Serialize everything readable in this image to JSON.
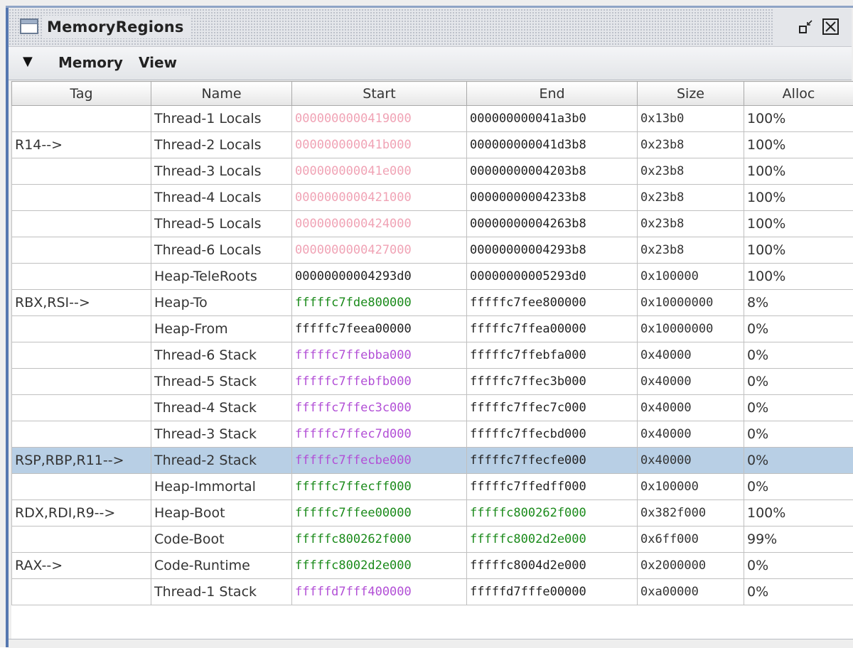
{
  "window": {
    "title": "MemoryRegions",
    "icons": {
      "window": "window-icon",
      "restore": "restore-icon",
      "close": "close-icon"
    }
  },
  "menubar": {
    "dropdown_icon": "▼",
    "items": [
      "Memory",
      "View"
    ]
  },
  "table": {
    "columns": [
      "Tag",
      "Name",
      "Start",
      "End",
      "Size",
      "Alloc"
    ],
    "selected_row_index": 13,
    "colors": {
      "pink": "#f0a3b5",
      "green": "#1a8a1a",
      "purple": "#b24fd6",
      "black": "#222222",
      "selected_bg": "#b8cfe5"
    },
    "rows": [
      {
        "tag": "",
        "name": "Thread-1 Locals",
        "start": "0000000000419000",
        "start_color": "pink",
        "end": "000000000041a3b0",
        "end_color": "black",
        "size": "0x13b0",
        "alloc": "100%"
      },
      {
        "tag": "R14-->",
        "name": "Thread-2 Locals",
        "start": "000000000041b000",
        "start_color": "pink",
        "end": "000000000041d3b8",
        "end_color": "black",
        "size": "0x23b8",
        "alloc": "100%"
      },
      {
        "tag": "",
        "name": "Thread-3 Locals",
        "start": "000000000041e000",
        "start_color": "pink",
        "end": "00000000004203b8",
        "end_color": "black",
        "size": "0x23b8",
        "alloc": "100%"
      },
      {
        "tag": "",
        "name": "Thread-4 Locals",
        "start": "0000000000421000",
        "start_color": "pink",
        "end": "00000000004233b8",
        "end_color": "black",
        "size": "0x23b8",
        "alloc": "100%"
      },
      {
        "tag": "",
        "name": "Thread-5 Locals",
        "start": "0000000000424000",
        "start_color": "pink",
        "end": "00000000004263b8",
        "end_color": "black",
        "size": "0x23b8",
        "alloc": "100%"
      },
      {
        "tag": "",
        "name": "Thread-6 Locals",
        "start": "0000000000427000",
        "start_color": "pink",
        "end": "00000000004293b8",
        "end_color": "black",
        "size": "0x23b8",
        "alloc": "100%"
      },
      {
        "tag": "",
        "name": "Heap-TeleRoots",
        "start": "00000000004293d0",
        "start_color": "black",
        "end": "00000000005293d0",
        "end_color": "black",
        "size": "0x100000",
        "alloc": "100%"
      },
      {
        "tag": "RBX,RSI-->",
        "name": "Heap-To",
        "start": "fffffc7fde800000",
        "start_color": "green",
        "end": "fffffc7fee800000",
        "end_color": "black",
        "size": "0x10000000",
        "alloc": "8%"
      },
      {
        "tag": "",
        "name": "Heap-From",
        "start": "fffffc7feea00000",
        "start_color": "black",
        "end": "fffffc7ffea00000",
        "end_color": "black",
        "size": "0x10000000",
        "alloc": "0%"
      },
      {
        "tag": "",
        "name": "Thread-6 Stack",
        "start": "fffffc7ffebba000",
        "start_color": "purple",
        "end": "fffffc7ffebfa000",
        "end_color": "black",
        "size": "0x40000",
        "alloc": "0%"
      },
      {
        "tag": "",
        "name": "Thread-5 Stack",
        "start": "fffffc7ffebfb000",
        "start_color": "purple",
        "end": "fffffc7ffec3b000",
        "end_color": "black",
        "size": "0x40000",
        "alloc": "0%"
      },
      {
        "tag": "",
        "name": "Thread-4 Stack",
        "start": "fffffc7ffec3c000",
        "start_color": "purple",
        "end": "fffffc7ffec7c000",
        "end_color": "black",
        "size": "0x40000",
        "alloc": "0%"
      },
      {
        "tag": "",
        "name": "Thread-3 Stack",
        "start": "fffffc7ffec7d000",
        "start_color": "purple",
        "end": "fffffc7ffecbd000",
        "end_color": "black",
        "size": "0x40000",
        "alloc": "0%"
      },
      {
        "tag": "RSP,RBP,R11-->",
        "name": "Thread-2 Stack",
        "start": "fffffc7ffecbe000",
        "start_color": "purple",
        "end": "fffffc7ffecfe000",
        "end_color": "black",
        "size": "0x40000",
        "alloc": "0%"
      },
      {
        "tag": "",
        "name": "Heap-Immortal",
        "start": "fffffc7ffecff000",
        "start_color": "green",
        "end": "fffffc7ffedff000",
        "end_color": "black",
        "size": "0x100000",
        "alloc": "0%"
      },
      {
        "tag": "RDX,RDI,R9-->",
        "name": "Heap-Boot",
        "start": "fffffc7ffee00000",
        "start_color": "green",
        "end": "fffffc800262f000",
        "end_color": "green",
        "size": "0x382f000",
        "alloc": "100%"
      },
      {
        "tag": "",
        "name": "Code-Boot",
        "start": "fffffc800262f000",
        "start_color": "green",
        "end": "fffffc8002d2e000",
        "end_color": "green",
        "size": "0x6ff000",
        "alloc": "99%"
      },
      {
        "tag": "RAX-->",
        "name": "Code-Runtime",
        "start": "fffffc8002d2e000",
        "start_color": "green",
        "end": "fffffc8004d2e000",
        "end_color": "black",
        "size": "0x2000000",
        "alloc": "0%"
      },
      {
        "tag": "",
        "name": "Thread-1 Stack",
        "start": "fffffd7fff400000",
        "start_color": "purple",
        "end": "fffffd7fffe00000",
        "end_color": "black",
        "size": "0xa00000",
        "alloc": "0%"
      }
    ]
  }
}
